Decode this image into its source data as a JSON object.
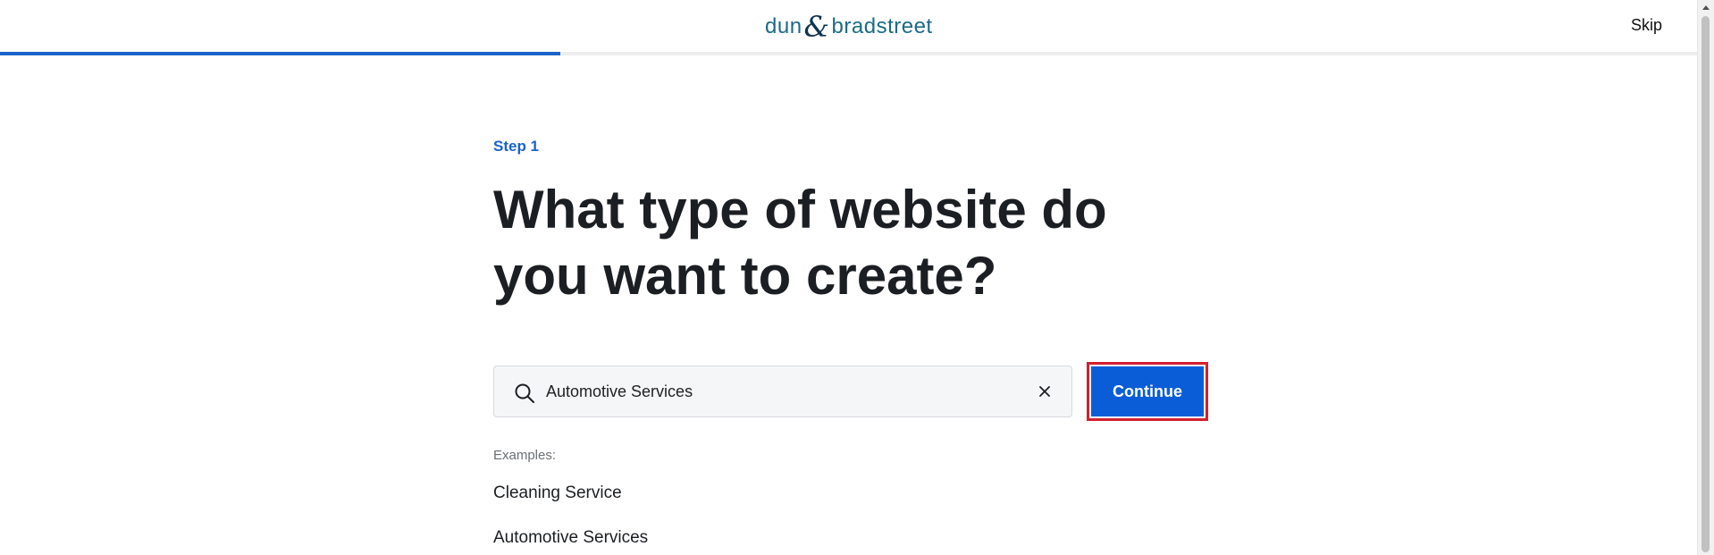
{
  "header": {
    "logo_left": "dun",
    "logo_amp": "&",
    "logo_right": "bradstreet",
    "skip_label": "Skip",
    "progress_percent": 33
  },
  "main": {
    "step_label": "Step 1",
    "title": "What type of website do you want to create?",
    "search": {
      "value": "Automotive Services",
      "placeholder": ""
    },
    "continue_label": "Continue",
    "examples_label": "Examples:",
    "examples": [
      "Cleaning Service",
      "Automotive Services"
    ]
  },
  "icons": {
    "search": "search-icon",
    "clear": "close-icon"
  },
  "colors": {
    "accent": "#1a64c8",
    "button": "#0a5dd6",
    "button_border": "#d2202f",
    "logo": "#1b6b87"
  }
}
